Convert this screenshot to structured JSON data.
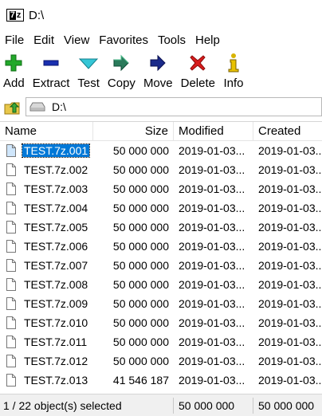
{
  "window": {
    "title": "D:\\",
    "app_icon_text": "7z"
  },
  "menu": [
    "File",
    "Edit",
    "View",
    "Favorites",
    "Tools",
    "Help"
  ],
  "toolbar": [
    {
      "label": "Add",
      "icon": "add-icon",
      "color": "#22a82a"
    },
    {
      "label": "Extract",
      "icon": "extract-icon",
      "color": "#1a2fb0"
    },
    {
      "label": "Test",
      "icon": "test-icon",
      "color": "#35c6d6"
    },
    {
      "label": "Copy",
      "icon": "copy-icon",
      "color": "#2a7a5a"
    },
    {
      "label": "Move",
      "icon": "move-icon",
      "color": "#1a2a8a"
    },
    {
      "label": "Delete",
      "icon": "delete-icon",
      "color": "#d81c1c"
    },
    {
      "label": "Info",
      "icon": "info-icon",
      "color": "#d8b400"
    }
  ],
  "address": {
    "path": "D:\\"
  },
  "columns": {
    "name": "Name",
    "size": "Size",
    "modified": "Modified",
    "created": "Created"
  },
  "files": [
    {
      "name": "TEST.7z.001",
      "size": "50 000 000",
      "modified": "2019-01-03...",
      "created": "2019-01-03...",
      "selected": true
    },
    {
      "name": "TEST.7z.002",
      "size": "50 000 000",
      "modified": "2019-01-03...",
      "created": "2019-01-03..."
    },
    {
      "name": "TEST.7z.003",
      "size": "50 000 000",
      "modified": "2019-01-03...",
      "created": "2019-01-03..."
    },
    {
      "name": "TEST.7z.004",
      "size": "50 000 000",
      "modified": "2019-01-03...",
      "created": "2019-01-03..."
    },
    {
      "name": "TEST.7z.005",
      "size": "50 000 000",
      "modified": "2019-01-03...",
      "created": "2019-01-03..."
    },
    {
      "name": "TEST.7z.006",
      "size": "50 000 000",
      "modified": "2019-01-03...",
      "created": "2019-01-03..."
    },
    {
      "name": "TEST.7z.007",
      "size": "50 000 000",
      "modified": "2019-01-03...",
      "created": "2019-01-03..."
    },
    {
      "name": "TEST.7z.008",
      "size": "50 000 000",
      "modified": "2019-01-03...",
      "created": "2019-01-03..."
    },
    {
      "name": "TEST.7z.009",
      "size": "50 000 000",
      "modified": "2019-01-03...",
      "created": "2019-01-03..."
    },
    {
      "name": "TEST.7z.010",
      "size": "50 000 000",
      "modified": "2019-01-03...",
      "created": "2019-01-03..."
    },
    {
      "name": "TEST.7z.011",
      "size": "50 000 000",
      "modified": "2019-01-03...",
      "created": "2019-01-03..."
    },
    {
      "name": "TEST.7z.012",
      "size": "50 000 000",
      "modified": "2019-01-03...",
      "created": "2019-01-03..."
    },
    {
      "name": "TEST.7z.013",
      "size": "41 546 187",
      "modified": "2019-01-03...",
      "created": "2019-01-03..."
    }
  ],
  "status": {
    "selection": "1 / 22 object(s) selected",
    "size": "50 000 000",
    "packed": "50 000 000"
  },
  "colors": {
    "selection": "#0078d7"
  }
}
